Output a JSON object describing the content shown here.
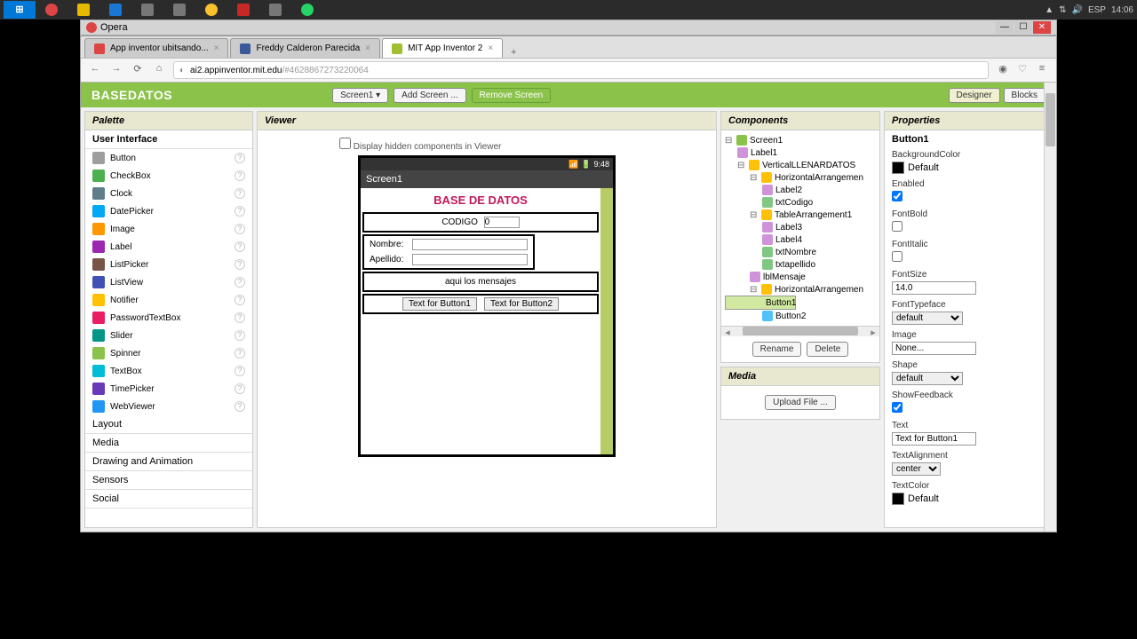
{
  "taskbar": {
    "lang": "ESP",
    "time": "14:06"
  },
  "opera": {
    "title": "Opera"
  },
  "tabs": [
    {
      "label": "App inventor ubitsando...",
      "active": false,
      "fav": "red"
    },
    {
      "label": "Freddy Calderon Parecida",
      "active": false,
      "fav": "fb"
    },
    {
      "label": "MIT App Inventor 2",
      "active": true,
      "fav": "ai"
    }
  ],
  "url": {
    "host": "ai2.appinventor.mit.edu",
    "path": "/#4628867273220064"
  },
  "ai": {
    "project": "BASEDATOS",
    "screen_dd": "Screen1 ▾",
    "add_screen": "Add Screen ...",
    "remove_screen": "Remove Screen",
    "designer": "Designer",
    "blocks": "Blocks"
  },
  "palette": {
    "title": "Palette",
    "cats": [
      "User Interface",
      "Layout",
      "Media",
      "Drawing and Animation",
      "Sensors",
      "Social"
    ],
    "ui_items": [
      "Button",
      "CheckBox",
      "Clock",
      "DatePicker",
      "Image",
      "Label",
      "ListPicker",
      "ListView",
      "Notifier",
      "PasswordTextBox",
      "Slider",
      "Spinner",
      "TextBox",
      "TimePicker",
      "WebViewer"
    ]
  },
  "viewer": {
    "title": "Viewer",
    "hidden_chk": "Display hidden components in Viewer",
    "phone_time": "9:48",
    "screen_name": "Screen1",
    "app_title": "BASE DE DATOS",
    "codigo_label": "CODIGO",
    "codigo_value": "0",
    "nombre_label": "Nombre:",
    "apellido_label": "Apellido:",
    "msg": "aqui los mensajes",
    "btn1": "Text for Button1",
    "btn2": "Text for Button2"
  },
  "components": {
    "title": "Components",
    "tree": {
      "screen": "Screen1",
      "label1": "Label1",
      "vert": "VerticalLLENARDATOS",
      "ha1": "HorizontalArrangemen",
      "label2": "Label2",
      "txtcodigo": "txtCodigo",
      "ta1": "TableArrangement1",
      "label3": "Label3",
      "label4": "Label4",
      "txtnombre": "txtNombre",
      "txtapellido": "txtapellido",
      "lblmsg": "lblMensaje",
      "ha2": "HorizontalArrangemen",
      "button1": "Button1",
      "button2": "Button2"
    },
    "rename": "Rename",
    "delete": "Delete"
  },
  "media": {
    "title": "Media",
    "upload": "Upload File ..."
  },
  "properties": {
    "title": "Properties",
    "target": "Button1",
    "bgcolor_lbl": "BackgroundColor",
    "bgcolor_val": "Default",
    "enabled_lbl": "Enabled",
    "fontbold_lbl": "FontBold",
    "fontitalic_lbl": "FontItalic",
    "fontsize_lbl": "FontSize",
    "fontsize_val": "14.0",
    "fonttype_lbl": "FontTypeface",
    "fonttype_val": "default",
    "image_lbl": "Image",
    "image_val": "None...",
    "shape_lbl": "Shape",
    "shape_val": "default",
    "feedback_lbl": "ShowFeedback",
    "text_lbl": "Text",
    "text_val": "Text for Button1",
    "textalign_lbl": "TextAlignment",
    "textalign_val": "center",
    "textcolor_lbl": "TextColor",
    "textcolor_val": "Default"
  }
}
